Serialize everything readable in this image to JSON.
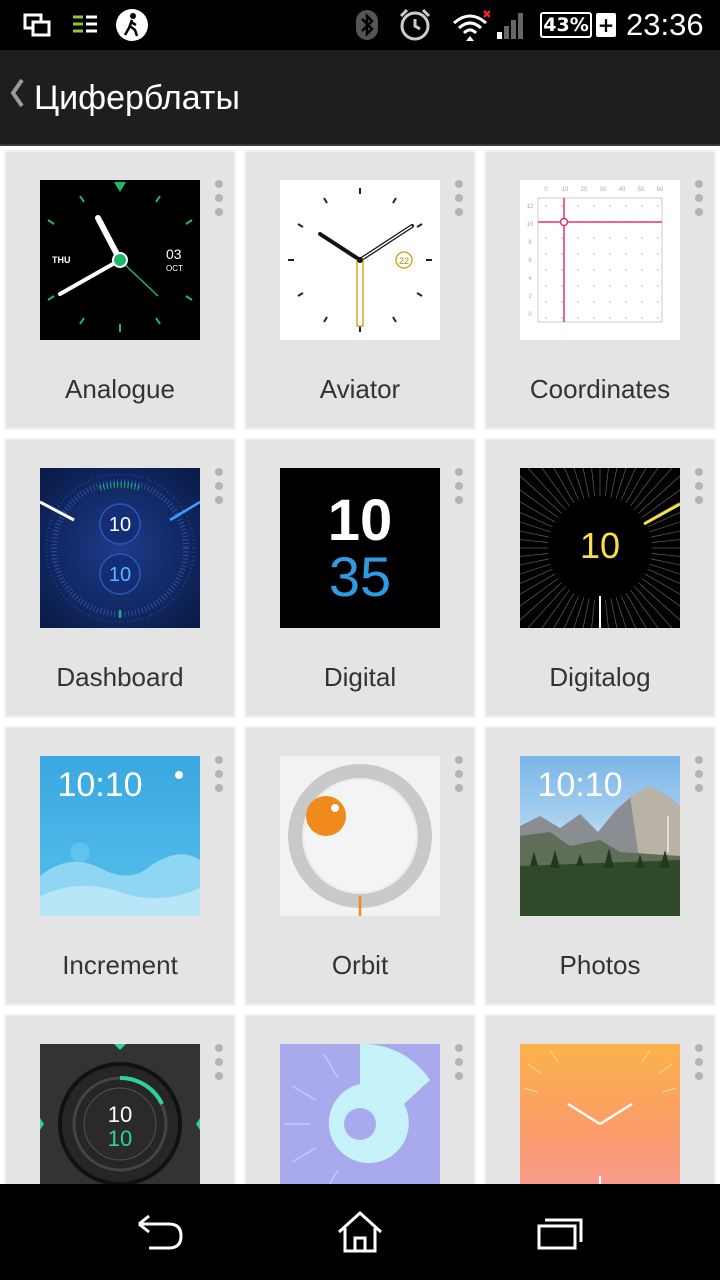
{
  "status_bar": {
    "icons": [
      "screen-mirror-icon",
      "data-sync-icon",
      "walking-icon",
      "bluetooth-icon",
      "alarm-icon",
      "wifi-icon",
      "signal-icon"
    ],
    "battery": "43%",
    "battery_charging": "+",
    "time": "23:36"
  },
  "header": {
    "back_icon": "chevron-left-icon",
    "title": "Циферблаты"
  },
  "watch_faces": [
    {
      "name": "Analogue",
      "thumb": "analogue",
      "date_day": "THU",
      "date_num": "03",
      "date_month": "OCT"
    },
    {
      "name": "Aviator",
      "thumb": "aviator",
      "date_num": "22"
    },
    {
      "name": "Coordinates",
      "thumb": "coordinates",
      "x_ticks": [
        "0",
        "10",
        "20",
        "30",
        "40",
        "50",
        "60"
      ],
      "y_ticks": [
        "12",
        "10",
        "8",
        "6",
        "4",
        "2",
        "0"
      ]
    },
    {
      "name": "Dashboard",
      "thumb": "dashboard",
      "hours": "10",
      "minutes": "10"
    },
    {
      "name": "Digital",
      "thumb": "digital",
      "hours": "10",
      "minutes": "35"
    },
    {
      "name": "Digitalog",
      "thumb": "digitalog",
      "hours": "10"
    },
    {
      "name": "Increment",
      "thumb": "increment",
      "time": "10:10"
    },
    {
      "name": "Orbit",
      "thumb": "orbit"
    },
    {
      "name": "Photos",
      "thumb": "photos",
      "time": "10:10"
    },
    {
      "name": "",
      "thumb": "ring",
      "hours": "10",
      "minutes": "10"
    },
    {
      "name": "",
      "thumb": "shapes"
    },
    {
      "name": "",
      "thumb": "sunrise"
    }
  ],
  "nav_bar": {
    "back": "back-arrow-icon",
    "home": "home-icon",
    "recents": "recent-apps-icon"
  },
  "colors": {
    "accent_green": "#1db86a",
    "digital_blue": "#2f9be0",
    "digitalog_yellow": "#f6e046",
    "orbit_orange": "#f08a1c"
  }
}
